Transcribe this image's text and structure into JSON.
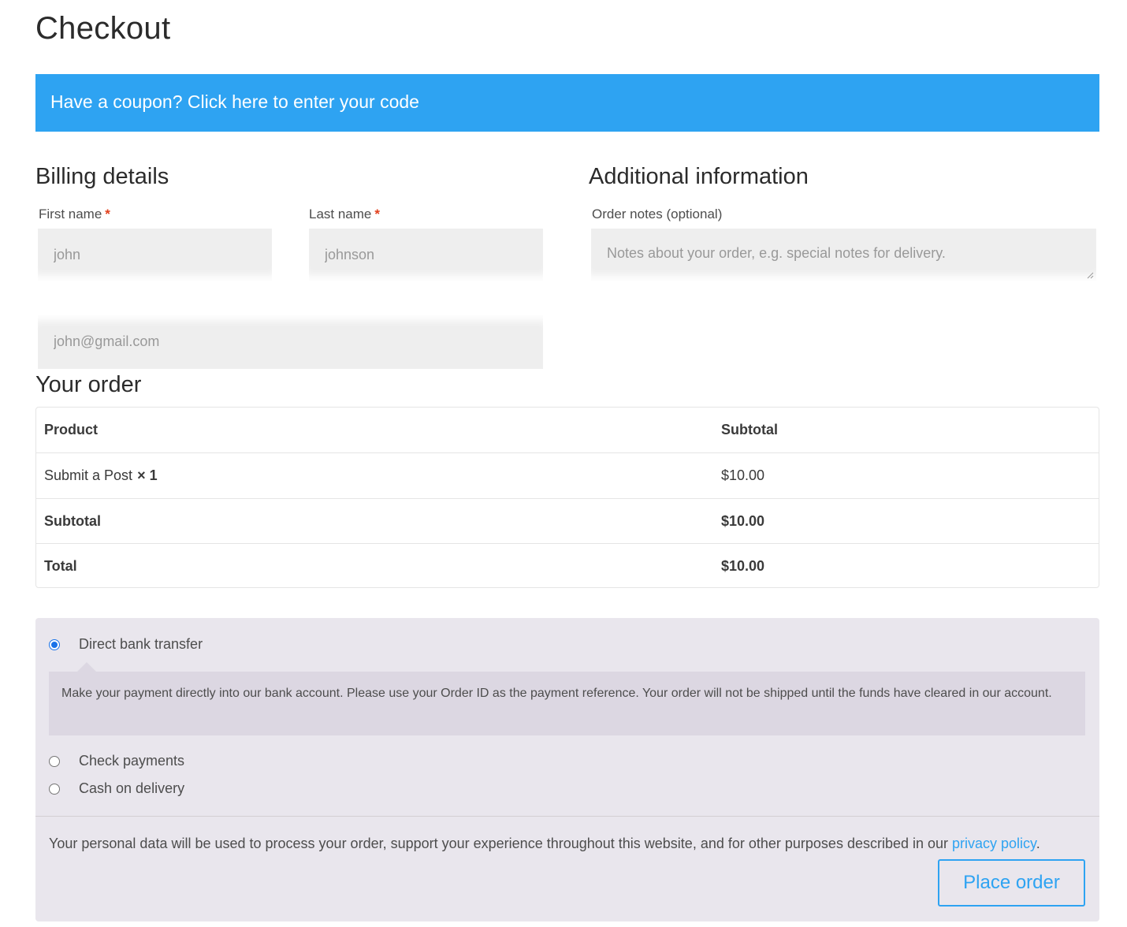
{
  "page": {
    "title": "Checkout"
  },
  "coupon": {
    "text": "Have a coupon? Click here to enter your code"
  },
  "billing": {
    "heading": "Billing details",
    "first_name": {
      "label": "First name",
      "required_mark": "*",
      "value": "john"
    },
    "last_name": {
      "label": "Last name",
      "required_mark": "*",
      "value": "johnson"
    },
    "email": {
      "value": "john@gmail.com"
    }
  },
  "additional": {
    "heading": "Additional information",
    "notes_label": "Order notes (optional)",
    "notes_placeholder": "Notes about your order, e.g. special notes for delivery."
  },
  "order": {
    "heading": "Your order",
    "columns": [
      "Product",
      "Subtotal"
    ],
    "items": [
      {
        "name": "Submit a Post",
        "qty": "× 1",
        "subtotal": "$10.00"
      }
    ],
    "subtotal_label": "Subtotal",
    "subtotal_value": "$10.00",
    "total_label": "Total",
    "total_value": "$10.00"
  },
  "payment": {
    "methods": [
      {
        "label": "Direct bank transfer",
        "selected": true
      },
      {
        "label": "Check payments",
        "selected": false
      },
      {
        "label": "Cash on delivery",
        "selected": false
      }
    ],
    "description": "Make your payment directly into our bank account. Please use your Order ID as the payment reference. Your order will not be shipped until the funds have cleared in our account.",
    "privacy_text": "Your personal data will be used to process your order, support your experience throughout this website, and for other purposes described in our ",
    "privacy_link": "privacy policy",
    "privacy_end": ".",
    "place_order_label": "Place order"
  },
  "colors": {
    "accent": "#2ea3f2",
    "payment_bg": "#e9e6ed",
    "required": "#e2401c"
  }
}
